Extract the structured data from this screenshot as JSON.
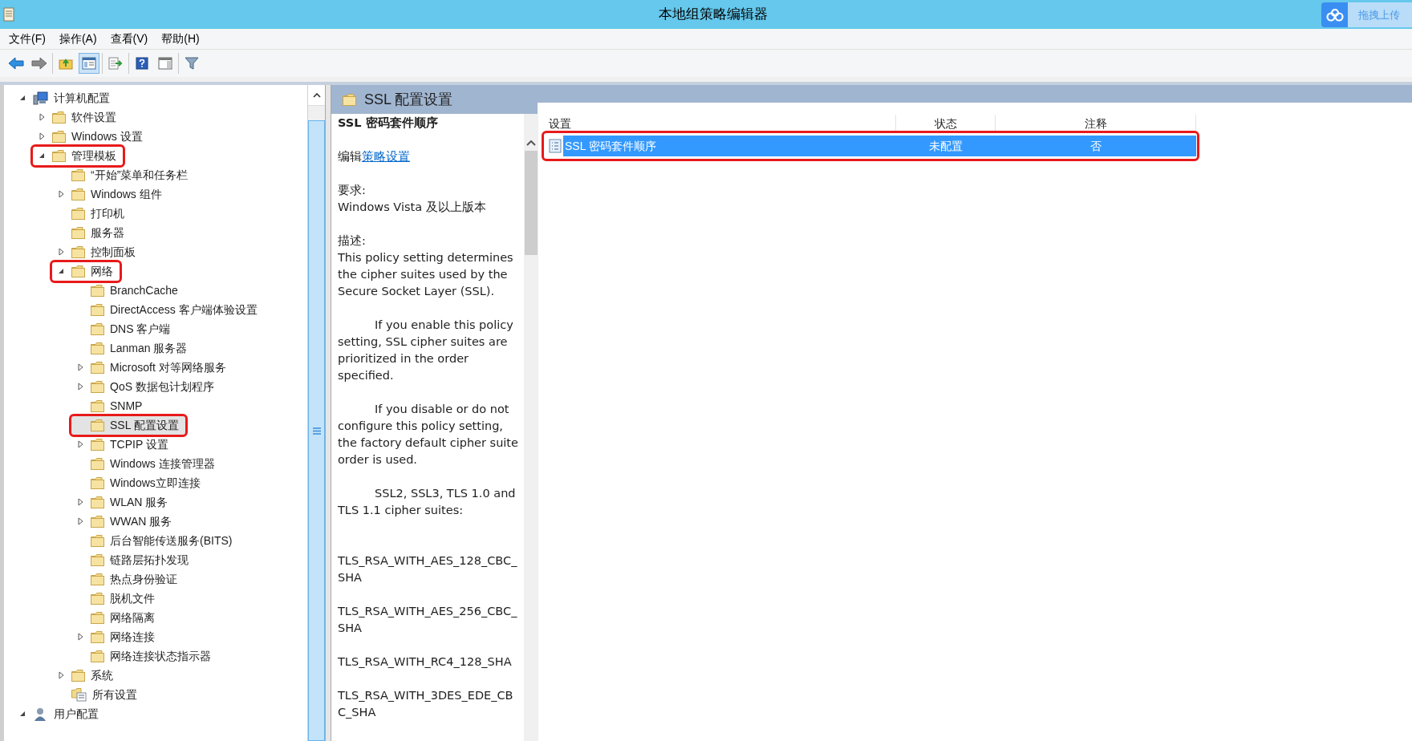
{
  "window": {
    "title": "本地组策略编辑器"
  },
  "upload_widget": {
    "label": "拖拽上传"
  },
  "menu": [
    "文件(F)",
    "操作(A)",
    "查看(V)",
    "帮助(H)"
  ],
  "toolbar": [
    [
      {
        "kind": "back",
        "pressed": false
      },
      {
        "kind": "forward",
        "pressed": false
      }
    ],
    [
      {
        "kind": "up",
        "pressed": false
      },
      {
        "kind": "tree",
        "pressed": true
      }
    ],
    [
      {
        "kind": "export",
        "pressed": false
      }
    ],
    [
      {
        "kind": "help",
        "pressed": false
      },
      {
        "kind": "pane",
        "pressed": false
      }
    ],
    [
      {
        "kind": "filter",
        "pressed": false
      }
    ]
  ],
  "tree": [
    {
      "label": "计算机配置",
      "kind": "computer",
      "expandable": true,
      "expanded": true,
      "selected": false,
      "annotated": false,
      "children": [
        {
          "label": "软件设置",
          "kind": "folder",
          "expandable": true,
          "expanded": false,
          "selected": false,
          "annotated": false
        },
        {
          "label": "Windows 设置",
          "kind": "folder",
          "expandable": true,
          "expanded": false,
          "selected": false,
          "annotated": false
        },
        {
          "label": "管理模板",
          "kind": "folder",
          "expandable": true,
          "expanded": true,
          "selected": false,
          "annotated": true,
          "children": [
            {
              "label": "“开始”菜单和任务栏",
              "kind": "folder",
              "expandable": false,
              "selected": false,
              "annotated": false
            },
            {
              "label": "Windows 组件",
              "kind": "folder",
              "expandable": true,
              "expanded": false,
              "selected": false,
              "annotated": false
            },
            {
              "label": "打印机",
              "kind": "folder",
              "expandable": false,
              "selected": false,
              "annotated": false
            },
            {
              "label": "服务器",
              "kind": "folder",
              "expandable": false,
              "selected": false,
              "annotated": false
            },
            {
              "label": "控制面板",
              "kind": "folder",
              "expandable": true,
              "expanded": false,
              "selected": false,
              "annotated": false
            },
            {
              "label": "网络",
              "kind": "folder",
              "expandable": true,
              "expanded": true,
              "selected": false,
              "annotated": true,
              "children": [
                {
                  "label": "BranchCache",
                  "kind": "folder",
                  "expandable": false,
                  "selected": false,
                  "annotated": false
                },
                {
                  "label": "DirectAccess 客户端体验设置",
                  "kind": "folder",
                  "expandable": false,
                  "selected": false,
                  "annotated": false
                },
                {
                  "label": "DNS 客户端",
                  "kind": "folder",
                  "expandable": false,
                  "selected": false,
                  "annotated": false
                },
                {
                  "label": "Lanman 服务器",
                  "kind": "folder",
                  "expandable": false,
                  "selected": false,
                  "annotated": false
                },
                {
                  "label": "Microsoft 对等网络服务",
                  "kind": "folder",
                  "expandable": true,
                  "expanded": false,
                  "selected": false,
                  "annotated": false
                },
                {
                  "label": "QoS 数据包计划程序",
                  "kind": "folder",
                  "expandable": true,
                  "expanded": false,
                  "selected": false,
                  "annotated": false
                },
                {
                  "label": "SNMP",
                  "kind": "folder",
                  "expandable": false,
                  "selected": false,
                  "annotated": false
                },
                {
                  "label": "SSL 配置设置",
                  "kind": "folder",
                  "expandable": false,
                  "selected": true,
                  "annotated": true
                },
                {
                  "label": "TCPIP 设置",
                  "kind": "folder",
                  "expandable": true,
                  "expanded": false,
                  "selected": false,
                  "annotated": false
                },
                {
                  "label": "Windows 连接管理器",
                  "kind": "folder",
                  "expandable": false,
                  "selected": false,
                  "annotated": false
                },
                {
                  "label": "Windows立即连接",
                  "kind": "folder",
                  "expandable": false,
                  "selected": false,
                  "annotated": false
                },
                {
                  "label": "WLAN 服务",
                  "kind": "folder",
                  "expandable": true,
                  "expanded": false,
                  "selected": false,
                  "annotated": false
                },
                {
                  "label": "WWAN 服务",
                  "kind": "folder",
                  "expandable": true,
                  "expanded": false,
                  "selected": false,
                  "annotated": false
                },
                {
                  "label": "后台智能传送服务(BITS)",
                  "kind": "folder",
                  "expandable": false,
                  "selected": false,
                  "annotated": false
                },
                {
                  "label": "链路层拓扑发现",
                  "kind": "folder",
                  "expandable": false,
                  "selected": false,
                  "annotated": false
                },
                {
                  "label": "热点身份验证",
                  "kind": "folder",
                  "expandable": false,
                  "selected": false,
                  "annotated": false
                },
                {
                  "label": "脱机文件",
                  "kind": "folder",
                  "expandable": false,
                  "selected": false,
                  "annotated": false
                },
                {
                  "label": "网络隔离",
                  "kind": "folder",
                  "expandable": false,
                  "selected": false,
                  "annotated": false
                },
                {
                  "label": "网络连接",
                  "kind": "folder",
                  "expandable": true,
                  "expanded": false,
                  "selected": false,
                  "annotated": false
                },
                {
                  "label": "网络连接状态指示器",
                  "kind": "folder",
                  "expandable": false,
                  "selected": false,
                  "annotated": false
                }
              ]
            },
            {
              "label": "系统",
              "kind": "folder",
              "expandable": true,
              "expanded": false,
              "selected": false,
              "annotated": false
            },
            {
              "label": "所有设置",
              "kind": "settings",
              "expandable": false,
              "selected": false,
              "annotated": false
            }
          ]
        }
      ]
    },
    {
      "label": "用户配置",
      "kind": "user",
      "expandable": true,
      "expanded": true,
      "selected": false,
      "annotated": false
    }
  ],
  "details": {
    "heading": "SSL 配置设置",
    "setting_name": "SSL 密码套件顺序",
    "edit_prefix": "编辑",
    "edit_link": "策略设置",
    "requirements_label": "要求:",
    "requirements": "Windows Vista 及以上版本",
    "description_label": "描述:",
    "paragraphs": [
      {
        "text": "This policy setting determines the cipher suites used by the Secure Socket Layer (SSL).",
        "indent": false
      },
      {
        "text": "If you enable this policy setting, SSL cipher suites are prioritized in the order specified.",
        "indent": true
      },
      {
        "text": "If you disable or do not configure this policy setting, the factory default cipher suite order is used.",
        "indent": true
      },
      {
        "text": "SSL2, SSL3, TLS 1.0 and TLS 1.1 cipher suites:",
        "indent": true
      },
      {
        "text": "TLS_RSA_WITH_AES_128_CBC_SHA",
        "indent": false
      },
      {
        "text": "TLS_RSA_WITH_AES_256_CBC_SHA",
        "indent": false
      },
      {
        "text": "TLS_RSA_WITH_RC4_128_SHA",
        "indent": false
      },
      {
        "text": "TLS_RSA_WITH_3DES_EDE_CBC_SHA",
        "indent": false
      }
    ]
  },
  "list": {
    "columns": [
      "设置",
      "状态",
      "注释"
    ],
    "rows": [
      {
        "cells": [
          "SSL 密码套件顺序",
          "未配置",
          "否"
        ],
        "selected": true,
        "annotated": true
      }
    ]
  }
}
